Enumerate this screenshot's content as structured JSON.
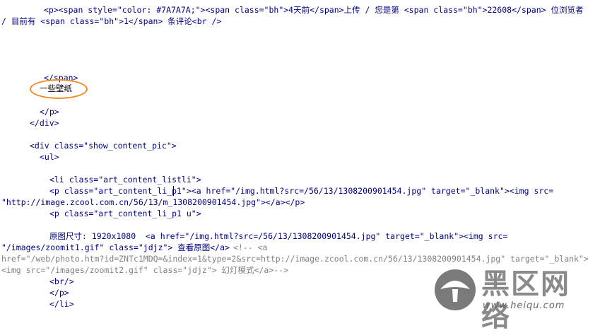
{
  "code": {
    "l1a": "<p><span style=\"color: #7A7A7A;\"><span class=\"bh\">4天前</span>上传 / 您是第 <span class=\"bh\">22608</span> 位浏览者",
    "l1b": "/ 目前有 <span class=\"bh\">1</span> 条评论<br />",
    "l_span_close": "</span>",
    "l_highlight_text": "一些壁纸",
    "l_p_close": "</p>",
    "l_div_close": "</div>",
    "l_div_open": "<div class=\"show_content_pic\">",
    "l_ul": "<ul>",
    "l_li": "<li class=\"art_content_listli\">",
    "l_p1_a": "<p class=\"art_content_li_p1\"><a href=\"/img.html?src=/56/13/1308200901454.jpg\" target=\"_blank\"><img src=",
    "l_p1_b": "\"http://image.zcool.com.cn/56/13/m_1308200901454.jpg\"></a></p>",
    "l_p1u": "<p class=\"art_content_li_p1 u\">",
    "l_size_a": "原图尺寸: 1920x1080  <a href=\"/img.html?src=/56/13/1308200901454.jpg\" target=\"_blank\"><img src=",
    "l_size_b": "\"/images/zoomit1.gif\" class=\"jdjz\"> 查看原图</a>",
    "l_size_c": "<!-- <a",
    "l_cmt1": "href=\"/web/photo.htm?id=ZNTc1MDQ=&index=1&type=2&src=http://image.zcool.com.cn/56/13/1308200901454.jpg\" target=\"_blank\">",
    "l_cmt2": "<img src=\"/images/zoomit2.gif\" class=\"jdjz\"> 幻灯模式</a>-->",
    "l_br": "<br/>",
    "l_p_close2": "</p>",
    "l_li_close": "</li>"
  },
  "watermark": {
    "title": "黑区网络",
    "url": "www.heiqu.com"
  },
  "colors": {
    "highlight": "#f08a20",
    "watermark": "#8a8a8a"
  }
}
